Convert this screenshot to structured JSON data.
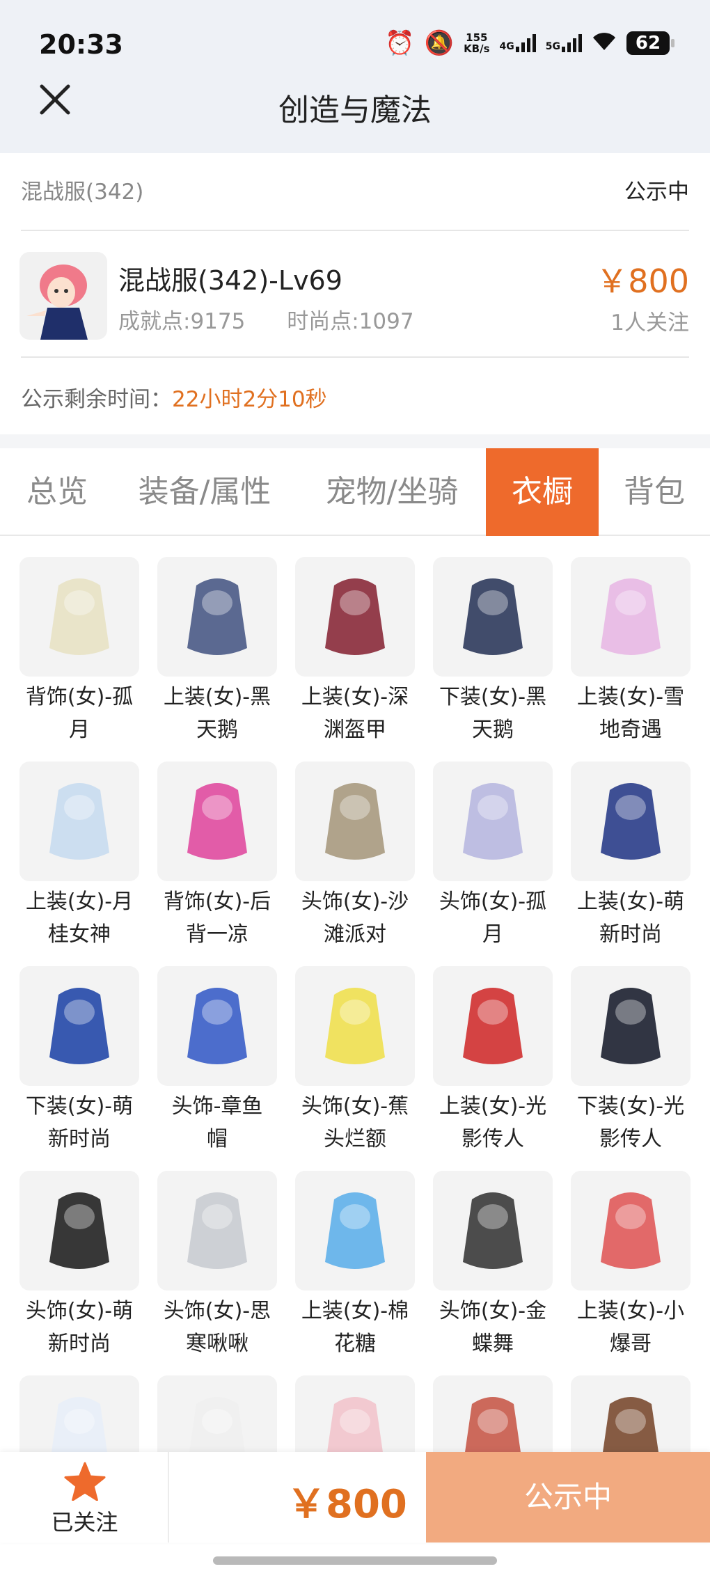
{
  "status_bar": {
    "time": "20:33",
    "net_speed_value": "155",
    "net_speed_unit": "KB/s",
    "net1": "4G",
    "net2": "5G",
    "battery": "62"
  },
  "header": {
    "close_icon": "close-icon",
    "title": "创造与魔法"
  },
  "server": {
    "name": "混战服(342)",
    "status": "公示中"
  },
  "character": {
    "name": "混战服(342)-Lv69",
    "achievement": "成就点:9175",
    "fashion": "时尚点:1097",
    "price": "￥800",
    "followers": "1人关注"
  },
  "countdown": {
    "label": "公示剩余时间：",
    "value": "22小时2分10秒"
  },
  "tabs": [
    {
      "label": "总览",
      "active": false
    },
    {
      "label": "装备/属性",
      "active": false
    },
    {
      "label": "宠物/坐骑",
      "active": false
    },
    {
      "label": "衣橱",
      "active": true
    },
    {
      "label": "背包",
      "active": false
    }
  ],
  "wardrobe": [
    {
      "line1": "背饰(女)-孤",
      "line2": "月",
      "icon": "ribbon-accessory-icon",
      "color": "#e8e2c4"
    },
    {
      "line1": "上装(女)-黑",
      "line2": "天鹅",
      "icon": "blue-gown-icon",
      "color": "#4a5a86"
    },
    {
      "line1": "上装(女)-深",
      "line2": "渊盔甲",
      "icon": "crimson-armor-icon",
      "color": "#8a2a3a"
    },
    {
      "line1": "下装(女)-黑",
      "line2": "天鹅",
      "icon": "high-heel-icon",
      "color": "#2e3a5c"
    },
    {
      "line1": "上装(女)-雪",
      "line2": "地奇遇",
      "icon": "pink-dress-icon",
      "color": "#e8b8e4"
    },
    {
      "line1": "上装(女)-月",
      "line2": "桂女神",
      "icon": "white-top-icon",
      "color": "#c8dcef"
    },
    {
      "line1": "背饰(女)-后",
      "line2": "背一凉",
      "icon": "icecream-icon",
      "color": "#e04ba0"
    },
    {
      "line1": "头饰(女)-沙",
      "line2": "滩派对",
      "icon": "straw-hat-icon",
      "color": "#a89a80"
    },
    {
      "line1": "头饰(女)-孤",
      "line2": "月",
      "icon": "lavender-hair-icon",
      "color": "#b8b8e0"
    },
    {
      "line1": "上装(女)-萌",
      "line2": "新时尚",
      "icon": "blue-corset-icon",
      "color": "#2a3d8a"
    },
    {
      "line1": "下装(女)-萌",
      "line2": "新时尚",
      "icon": "blue-pants-icon",
      "color": "#2448a8"
    },
    {
      "line1": "头饰-章鱼",
      "line2": "帽",
      "icon": "octopus-hat-icon",
      "color": "#3a5ec8"
    },
    {
      "line1": "头饰(女)-蕉",
      "line2": "头烂额",
      "icon": "banana-hat-icon",
      "color": "#f0e050"
    },
    {
      "line1": "上装(女)-光",
      "line2": "影传人",
      "icon": "red-jacket-icon",
      "color": "#d03030"
    },
    {
      "line1": "下装(女)-光",
      "line2": "影传人",
      "icon": "black-skirt-icon",
      "color": "#1c2030"
    },
    {
      "line1": "头饰(女)-萌",
      "line2": "新时尚",
      "icon": "black-bun-hair-icon",
      "color": "#222222"
    },
    {
      "line1": "头饰(女)-思",
      "line2": "寒啾啾",
      "icon": "silver-hair-icon",
      "color": "#c9ccd2"
    },
    {
      "line1": "上装(女)-棉",
      "line2": "花糖",
      "icon": "cloud-dress-icon",
      "color": "#5fb0ea"
    },
    {
      "line1": "头饰(女)-金",
      "line2": "蝶舞",
      "icon": "dark-hair-icon",
      "color": "#3a3a3a"
    },
    {
      "line1": "上装(女)-小",
      "line2": "爆哥",
      "icon": "red-hoodie-icon",
      "color": "#e05a5a"
    },
    {
      "line1": "",
      "line2": "",
      "icon": "star-shirt-icon",
      "color": "#e8eef8"
    },
    {
      "line1": "",
      "line2": "",
      "icon": "bunny-hat-icon",
      "color": "#f0f0f0"
    },
    {
      "line1": "",
      "line2": "",
      "icon": "pink-stockings-icon",
      "color": "#f2c4cc"
    },
    {
      "line1": "",
      "line2": "",
      "icon": "red-feather-icon",
      "color": "#c85a4a"
    },
    {
      "line1": "",
      "line2": "",
      "icon": "brown-ponytail-icon",
      "color": "#7a4a30"
    }
  ],
  "bottom_bar": {
    "follow_label": "已关注",
    "price": "￥800",
    "action_label": "公示中"
  },
  "colors": {
    "accent": "#ee6a2c",
    "price": "#e07020",
    "action_bg": "#f2aa80",
    "header_bg": "#eef1f6"
  }
}
